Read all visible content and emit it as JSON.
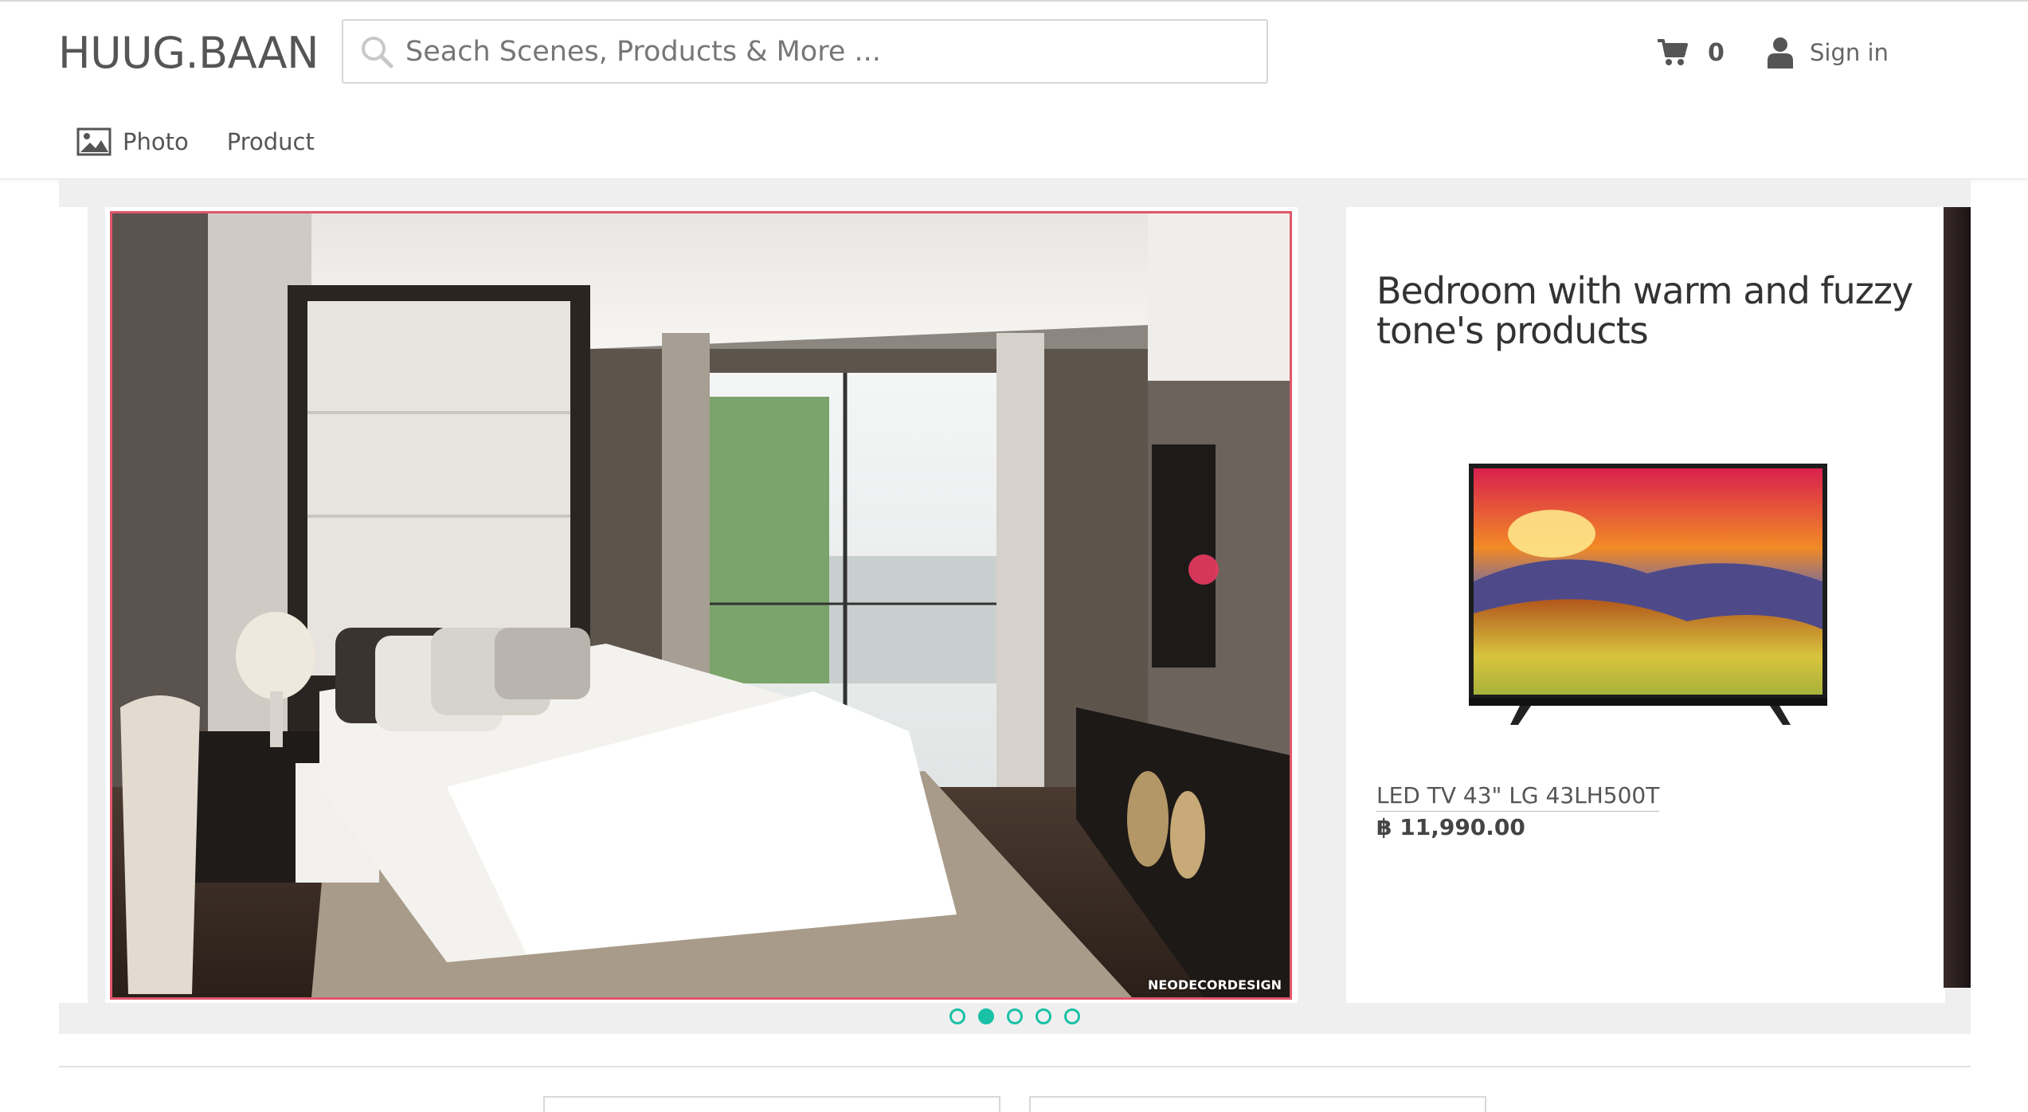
{
  "brand": {
    "name": "HUUG.BAAN"
  },
  "search": {
    "placeholder": "Seach Scenes, Products & More ...",
    "icon": "search-icon"
  },
  "cart": {
    "icon": "cart-icon",
    "count": "0"
  },
  "account": {
    "icon": "user-icon",
    "label": "Sign in"
  },
  "subnav": [
    {
      "label": "Photo",
      "icon": "image-icon"
    },
    {
      "label": "Product"
    }
  ],
  "hero": {
    "watermark": "NEODECORDESIGN",
    "title": "Bedroom with warm and fuzzy tone's products",
    "product": {
      "name": "LED TV 43\" LG 43LH500T",
      "price": "฿ 11,990.00"
    },
    "carousel": {
      "total": 5,
      "active_index": 1
    }
  },
  "colors": {
    "accent": "#19c1a6",
    "hotspot": "#e5395f",
    "frame": "#e0566a"
  }
}
